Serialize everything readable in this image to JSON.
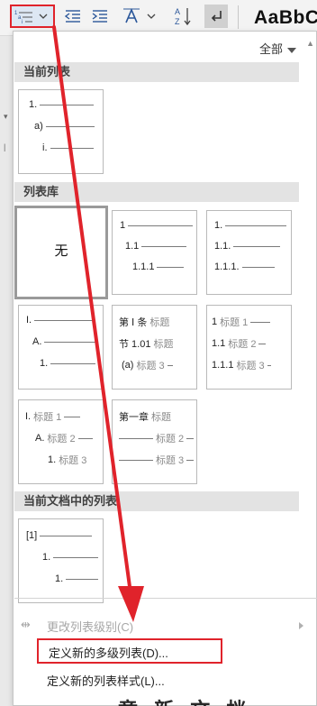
{
  "ribbon": {
    "style_preview": "AaBbC"
  },
  "dropdown": {
    "filter_label": "全部",
    "sections": {
      "current_list": "当前列表",
      "list_library": "列表库",
      "lists_in_doc": "当前文档中的列表"
    },
    "current_list_tile": {
      "rows": [
        "1.",
        "a)",
        "i."
      ]
    },
    "library": {
      "none_label": "无",
      "tile_1": {
        "rows": [
          "1",
          "1.1",
          "1.1.1"
        ]
      },
      "tile_2": {
        "rows": [
          "1.",
          "1.1.",
          "1.1.1."
        ]
      },
      "tile_3": {
        "rows": [
          "I.",
          "A.",
          "1."
        ]
      },
      "tile_4": {
        "rows": [
          {
            "num": "第 Ⅰ 条",
            "label": "标题"
          },
          {
            "num": "节 1.01",
            "label": "标题"
          },
          {
            "num": "(a)",
            "label": "标题 3"
          }
        ]
      },
      "tile_5": {
        "rows": [
          {
            "num": "1",
            "label": "标题 1"
          },
          {
            "num": "1.1",
            "label": "标题 2"
          },
          {
            "num": "1.1.1",
            "label": "标题 3"
          }
        ]
      },
      "tile_6": {
        "rows": [
          {
            "num": "I.",
            "label": "标题 1"
          },
          {
            "num": "A.",
            "label": "标题 2"
          },
          {
            "num": "1.",
            "label": "标题 3"
          }
        ]
      },
      "tile_7": {
        "rows": [
          {
            "num": "第一章",
            "label": "标题"
          },
          {
            "num": "",
            "label": "标题 2"
          },
          {
            "num": "",
            "label": "标题 3"
          }
        ]
      }
    },
    "doc_list_tile": {
      "rows": [
        "[1]",
        "1.",
        "1."
      ]
    },
    "menu": {
      "change_level": "更改列表级别(C)",
      "define_multilevel": "定义新的多级列表(D)...",
      "define_style": "定义新的列表样式(L)..."
    }
  },
  "doc_peek": "章 新 文 档",
  "colors": {
    "highlight_border": "#e0232b",
    "arrow": "#e0232b",
    "section_header_bg": "#e3e3e3",
    "ribbon_icon": "#2b579a"
  }
}
